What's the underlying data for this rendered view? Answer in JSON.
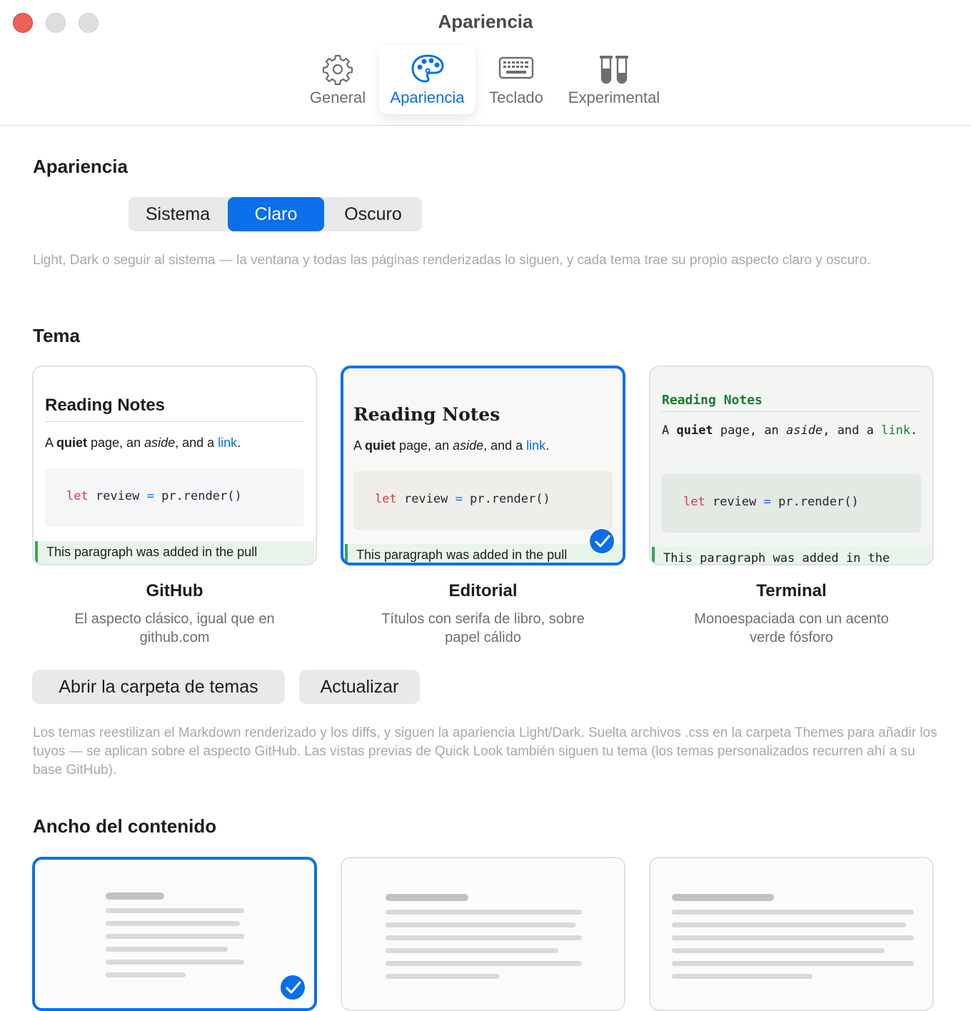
{
  "window": {
    "title": "Apariencia"
  },
  "tabs": [
    {
      "label": "General",
      "icon": "gear-icon"
    },
    {
      "label": "Apariencia",
      "icon": "palette-icon",
      "active": true
    },
    {
      "label": "Teclado",
      "icon": "keyboard-icon"
    },
    {
      "label": "Experimental",
      "icon": "test-tubes-icon"
    }
  ],
  "appearance": {
    "title": "Apariencia",
    "options": [
      "Sistema",
      "Claro",
      "Oscuro"
    ],
    "selected": "Claro",
    "help": "Light, Dark o seguir al sistema — la ventana y todas las páginas renderizadas lo siguen, y cada tema trae su propio aspecto claro y oscuro."
  },
  "theme": {
    "title": "Tema",
    "preview": {
      "heading": "Reading Notes",
      "para_a": "A ",
      "para_bold": "quiet",
      "para_b": " page, an ",
      "para_italic": "aside",
      "para_c": ", and a ",
      "para_link": "link",
      "para_d": ".",
      "code_kw": "let",
      "code_var": " review ",
      "code_op": "=",
      "code_rest": " pr.render()",
      "added": "This paragraph was added in the pull",
      "added_terminal": "This paragraph was added in the"
    },
    "cards": [
      {
        "name": "GitHub",
        "description": "El aspecto clásico, igual que en github.com",
        "selected": false
      },
      {
        "name": "Editorial",
        "description": "Títulos con serifa de libro, sobre papel cálido",
        "selected": true
      },
      {
        "name": "Terminal",
        "description": "Monoespaciada con un acento verde fósforo",
        "selected": false
      }
    ],
    "open_folder_label": "Abrir la carpeta de temas",
    "refresh_label": "Actualizar",
    "help": "Los temas reestilizan el Markdown renderizado y los diffs, y siguen la apariencia Light/Dark. Suelta archivos .css en la carpeta Themes para añadir los tuyos — se aplican sobre el aspecto GitHub. Las vistas previas de Quick Look también siguen tu tema (los temas personalizados recurren ahí a su base GitHub)."
  },
  "content_width": {
    "title": "Ancho del contenido",
    "selected_index": 0
  },
  "colors": {
    "accent": "#0a6fe8",
    "close": "#ed5f57",
    "terminal_green": "#1e7a2e",
    "code_keyword": "#d73a49"
  }
}
